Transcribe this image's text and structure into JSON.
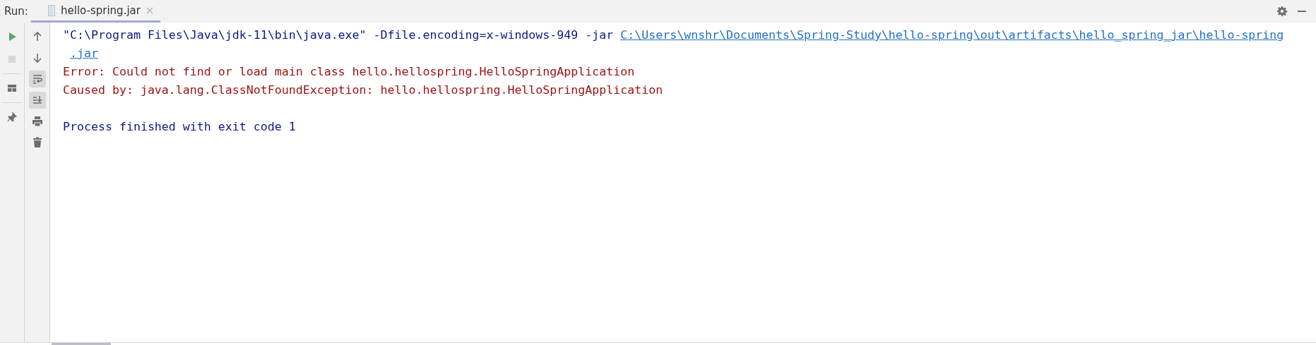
{
  "header": {
    "label": "Run:",
    "tabs": [
      {
        "title": "hello-spring.jar",
        "selected": true
      }
    ]
  },
  "side_tools": [
    {
      "kind": "rerun",
      "disabled": false
    },
    {
      "kind": "stop",
      "disabled": true
    },
    {
      "kind": "layout",
      "disabled": false
    },
    {
      "kind": "pin",
      "disabled": false
    }
  ],
  "console_tools": [
    {
      "kind": "up",
      "on": false
    },
    {
      "kind": "down",
      "on": false
    },
    {
      "kind": "wrap",
      "on": true
    },
    {
      "kind": "scroll-end",
      "on": true
    },
    {
      "kind": "print",
      "on": false
    },
    {
      "kind": "clear",
      "on": false
    }
  ],
  "console": [
    {
      "kind": "command",
      "segments": [
        {
          "kind": "plain",
          "text": "\"C:\\Program Files\\Java\\jdk-11\\bin\\java.exe\" -Dfile.encoding=x-windows-949 -jar "
        },
        {
          "kind": "link",
          "text": "C:\\Users\\wnshr\\Documents\\Spring-Study\\hello-spring\\out\\artifacts\\hello_spring_jar\\hello-spring"
        }
      ]
    },
    {
      "kind": "continuation",
      "segments": [
        {
          "kind": "link",
          "text": ".jar"
        }
      ]
    },
    {
      "kind": "error",
      "segments": [
        {
          "kind": "plain",
          "text": "Error: Could not find or load main class hello.hellospring.HelloSpringApplication"
        }
      ]
    },
    {
      "kind": "error",
      "segments": [
        {
          "kind": "plain",
          "text": "Caused by: java.lang.ClassNotFoundException: hello.hellospring.HelloSpringApplication"
        }
      ]
    },
    {
      "kind": "blank"
    },
    {
      "kind": "info",
      "segments": [
        {
          "kind": "plain",
          "text": "Process finished with exit code 1"
        }
      ]
    }
  ]
}
